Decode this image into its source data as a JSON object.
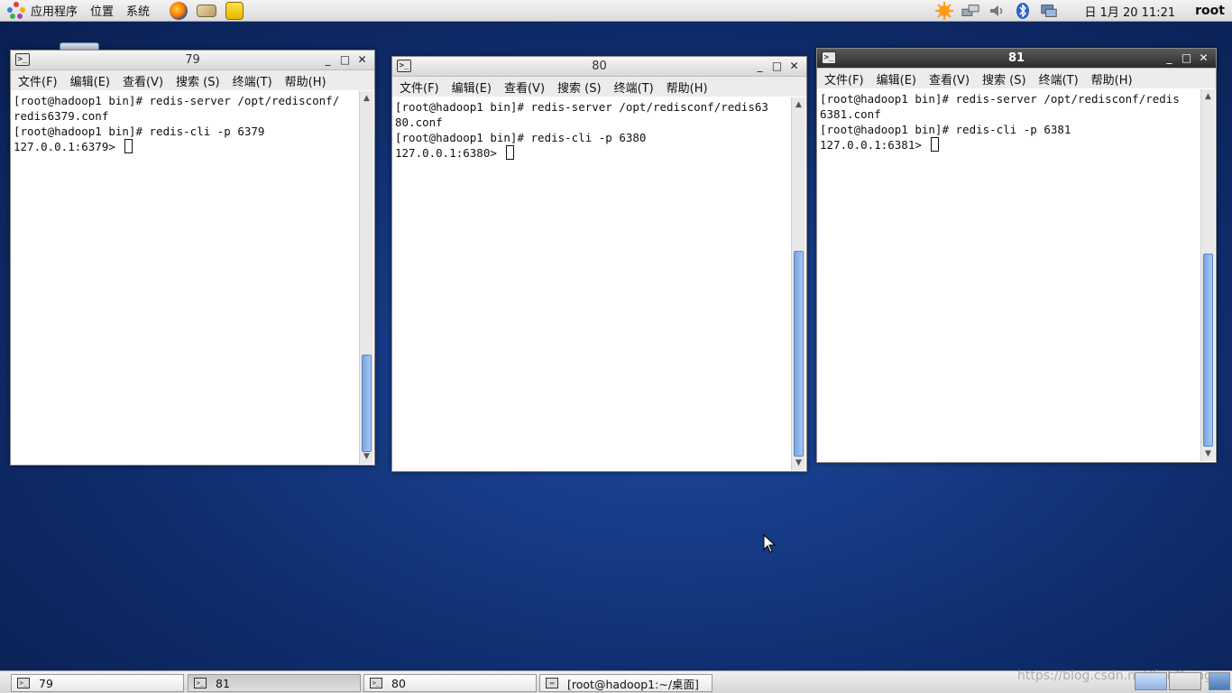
{
  "top_panel": {
    "menus": [
      "应用程序",
      "位置",
      "系统"
    ],
    "launchers": [
      "firefox-icon",
      "network-drive-icon",
      "text-editor-icon"
    ],
    "tray_icons": [
      "update-icon",
      "network-icon",
      "volume-icon",
      "bluetooth-icon",
      "display-icon"
    ],
    "clock": "日 1月 20 11:21",
    "user": "root"
  },
  "menu_labels": [
    "文件(F)",
    "编辑(E)",
    "查看(V)",
    "搜索 (S)",
    "终端(T)",
    "帮助(H)"
  ],
  "windows": [
    {
      "title": "79",
      "lines": [
        "[root@hadoop1 bin]# redis-server /opt/redisconf/",
        "redis6379.conf",
        "[root@hadoop1 bin]# redis-cli -p 6379",
        "127.0.0.1:6379> "
      ]
    },
    {
      "title": "80",
      "lines": [
        "[root@hadoop1 bin]# redis-server /opt/redisconf/redis63",
        "80.conf",
        "[root@hadoop1 bin]# redis-cli -p 6380",
        "127.0.0.1:6380> "
      ]
    },
    {
      "title": "81",
      "lines": [
        "[root@hadoop1 bin]# redis-server /opt/redisconf/redis",
        "6381.conf",
        "[root@hadoop1 bin]# redis-cli -p 6381",
        "127.0.0.1:6381> "
      ]
    }
  ],
  "window_controls": {
    "minimize": "_",
    "maximize": "□",
    "close": "✕"
  },
  "taskbar": {
    "items": [
      "79",
      "81",
      "80",
      "[root@hadoop1:~/桌面]"
    ]
  },
  "watermark": "https://blog.csdn.net/fishQiang"
}
